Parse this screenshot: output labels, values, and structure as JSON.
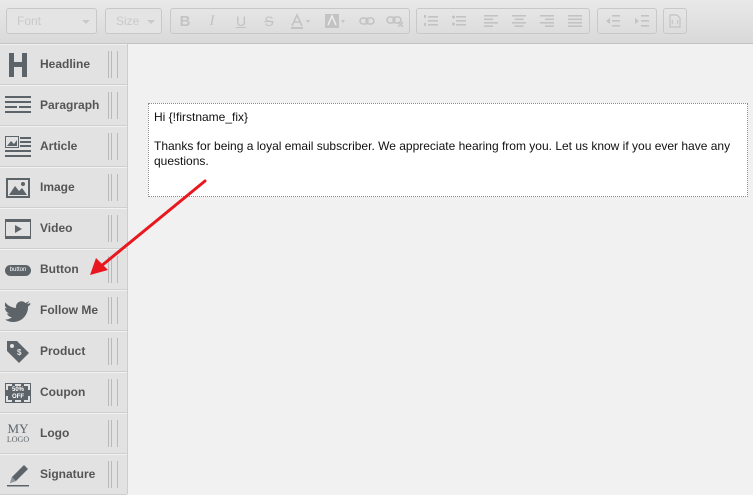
{
  "toolbar": {
    "font_placeholder": "Font",
    "size_placeholder": "Size",
    "buttons": [
      {
        "name": "bold",
        "glyph": "B"
      },
      {
        "name": "italic",
        "glyph": "I"
      },
      {
        "name": "underline",
        "glyph": "U"
      },
      {
        "name": "strikethrough",
        "glyph": "S"
      }
    ]
  },
  "sidebar": {
    "items": [
      {
        "label": "Headline",
        "icon": "headline-icon"
      },
      {
        "label": "Paragraph",
        "icon": "paragraph-icon"
      },
      {
        "label": "Article",
        "icon": "article-icon"
      },
      {
        "label": "Image",
        "icon": "image-icon"
      },
      {
        "label": "Video",
        "icon": "video-icon"
      },
      {
        "label": "Button",
        "icon": "button-icon",
        "icon_text": "button"
      },
      {
        "label": "Follow Me",
        "icon": "twitter-bird-icon"
      },
      {
        "label": "Product",
        "icon": "price-tag-icon",
        "icon_text": "$"
      },
      {
        "label": "Coupon",
        "icon": "coupon-icon",
        "icon_text_1": "50%",
        "icon_text_2": "OFF"
      },
      {
        "label": "Logo",
        "icon": "logo-icon",
        "icon_text_1": "MY",
        "icon_text_2": "LOGO"
      },
      {
        "label": "Signature",
        "icon": "pen-icon"
      }
    ]
  },
  "editor": {
    "greeting": "Hi {!firstname_fix}",
    "body": "Thanks for being a loyal email subscriber. We appreciate hearing from you. Let us know if you ever have any questions."
  },
  "colors": {
    "annotation_arrow": "#e8181e",
    "icon": "#5d6469"
  }
}
